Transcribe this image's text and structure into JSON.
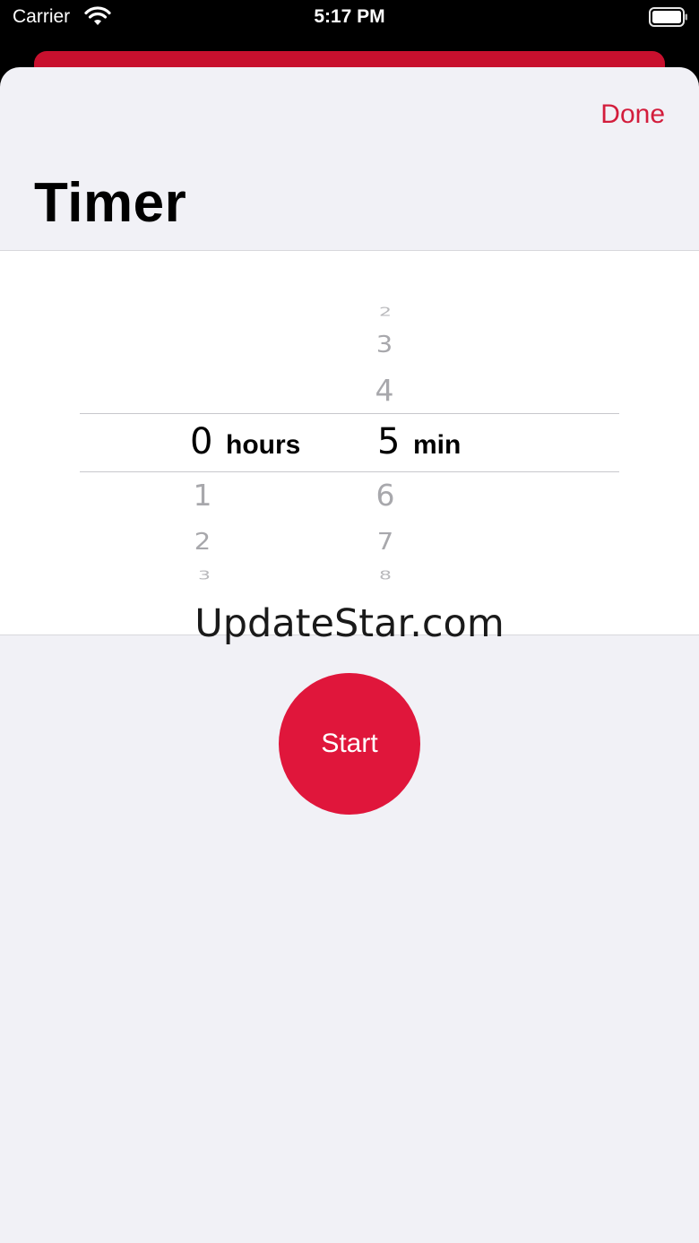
{
  "status_bar": {
    "carrier": "Carrier",
    "time": "5:17 PM"
  },
  "header": {
    "done_label": "Done",
    "title": "Timer"
  },
  "picker": {
    "hours": {
      "above": [
        "",
        "",
        ""
      ],
      "selected": "0",
      "unit": "hours",
      "below": [
        "1",
        "2",
        "3"
      ]
    },
    "minutes": {
      "above": [
        "2",
        "3",
        "4"
      ],
      "selected": "5",
      "unit": "min",
      "below": [
        "6",
        "7",
        "8"
      ]
    }
  },
  "watermark": "UpdateStar.com",
  "start_label": "Start",
  "colors": {
    "accent": "#d31d3c",
    "start_button": "#e0163b"
  }
}
